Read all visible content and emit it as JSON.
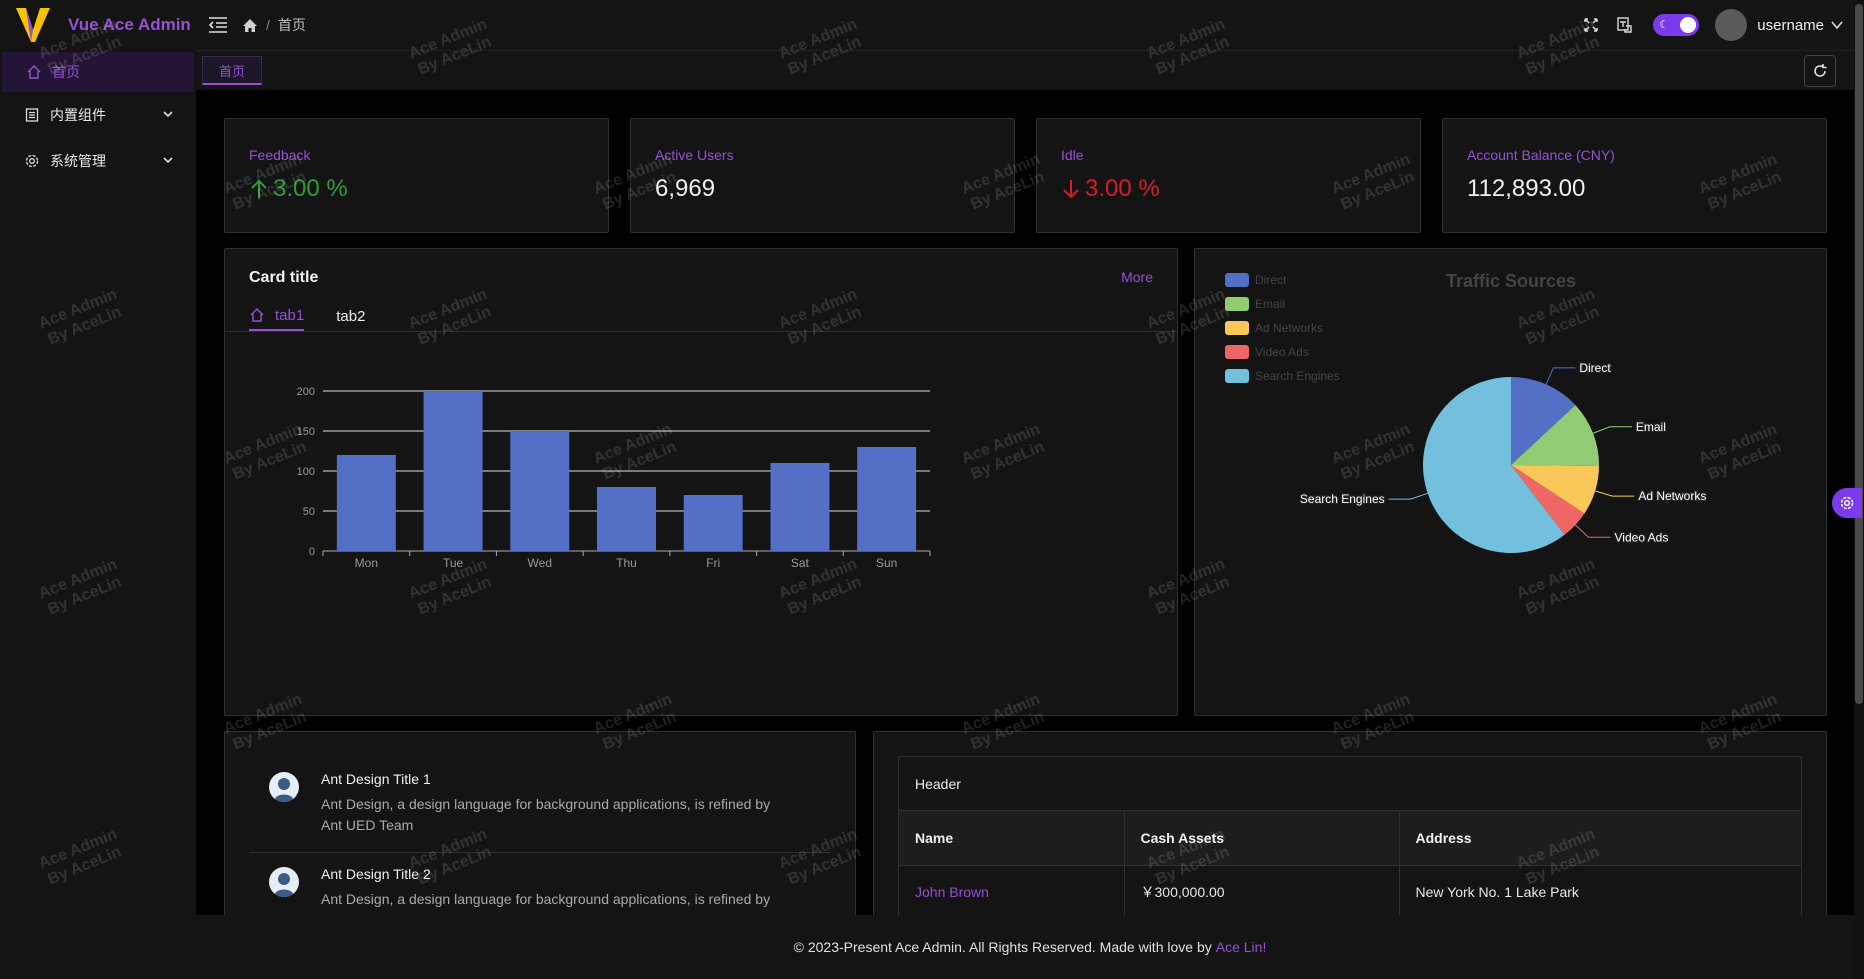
{
  "app": {
    "title": "Vue Ace Admin"
  },
  "sidebar": {
    "items": [
      {
        "label": "首页",
        "icon": "home-icon",
        "active": true
      },
      {
        "label": "内置组件",
        "icon": "file-list-icon"
      },
      {
        "label": "系统管理",
        "icon": "gear-icon"
      }
    ]
  },
  "header": {
    "breadcrumb": [
      "首页"
    ],
    "username": "username"
  },
  "tabs": {
    "current": "首页"
  },
  "stats": [
    {
      "title": "Feedback",
      "value": "3.00 %",
      "trend": "up",
      "color": "#2e9c3c"
    },
    {
      "title": "Active Users",
      "value": "6,969"
    },
    {
      "title": "Idle",
      "value": "3.00 %",
      "trend": "down",
      "color": "#d21f2a"
    },
    {
      "title": "Account Balance (CNY)",
      "value": "112,893.00"
    }
  ],
  "main_card": {
    "title": "Card title",
    "more": "More",
    "tabs": [
      "tab1",
      "tab2"
    ]
  },
  "chart_data": [
    {
      "type": "bar",
      "categories": [
        "Mon",
        "Tue",
        "Wed",
        "Thu",
        "Fri",
        "Sat",
        "Sun"
      ],
      "values": [
        120,
        200,
        150,
        80,
        70,
        110,
        130
      ],
      "ylim": [
        0,
        200
      ],
      "yticks": [
        0,
        50,
        100,
        150,
        200
      ],
      "color": "#5470c6",
      "grid": true
    },
    {
      "type": "pie",
      "title": "Traffic Sources",
      "legend_position": "top-left",
      "slices": [
        {
          "name": "Direct",
          "value": 335,
          "color": "#5470c6"
        },
        {
          "name": "Email",
          "value": 310,
          "color": "#91cc75"
        },
        {
          "name": "Ad Networks",
          "value": 234,
          "color": "#fac858"
        },
        {
          "name": "Video Ads",
          "value": 135,
          "color": "#ee6666"
        },
        {
          "name": "Search Engines",
          "value": 1548,
          "color": "#73c0de"
        }
      ]
    }
  ],
  "list": [
    {
      "title": "Ant Design Title 1",
      "desc": "Ant Design, a design language for background applications, is refined by Ant UED Team"
    },
    {
      "title": "Ant Design Title 2",
      "desc": "Ant Design, a design language for background applications, is refined by Ant UED Team"
    }
  ],
  "table": {
    "header": "Header",
    "columns": [
      "Name",
      "Cash Assets",
      "Address"
    ],
    "rows": [
      [
        "John Brown",
        "￥300,000.00",
        "New York No. 1 Lake Park"
      ]
    ]
  },
  "footer": {
    "text": "© 2023-Present Ace Admin. All Rights Reserved. Made with love by",
    "author": "Ace Lin!"
  },
  "watermark": {
    "line1": "Ace Admin",
    "line2": "By AceLin"
  },
  "colors": {
    "accent": "#9650d4",
    "bg": "#000000",
    "panel": "#141414"
  }
}
